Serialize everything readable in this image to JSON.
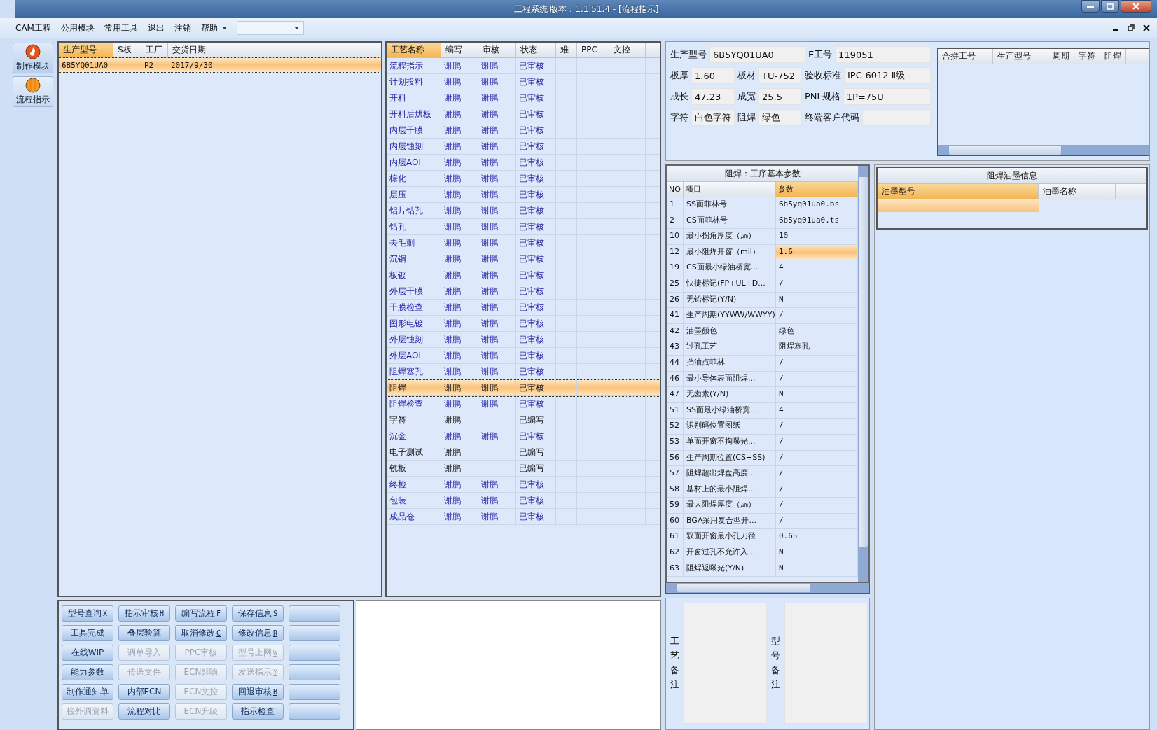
{
  "window": {
    "title": "工程系统   版本：1.1.51.4 - [流程指示]"
  },
  "menu": {
    "items": [
      "CAM工程",
      "公用模块",
      "常用工具",
      "退出",
      "注销",
      "帮助"
    ]
  },
  "nav": [
    {
      "label": "制作模块",
      "selected": true
    },
    {
      "label": "流程指示",
      "selected": false
    }
  ],
  "orders": {
    "columns": [
      {
        "label": "生产型号",
        "sorted": true
      },
      {
        "label": "S板",
        "sorted": false
      },
      {
        "label": "工厂",
        "sorted": false
      },
      {
        "label": "交货日期",
        "sorted": false
      }
    ],
    "rows": [
      {
        "model": "6B5YQ01UA0",
        "factory": "P2",
        "date": "2017/9/30",
        "selected": true
      }
    ]
  },
  "process": {
    "columns": [
      {
        "label": "工艺名称",
        "sorted": true
      },
      {
        "label": "编写",
        "sorted": false
      },
      {
        "label": "审核",
        "sorted": false
      },
      {
        "label": "状态",
        "sorted": false
      },
      {
        "label": "难",
        "sorted": false
      },
      {
        "label": "PPC",
        "sorted": false
      },
      {
        "label": "文控",
        "sorted": false
      }
    ],
    "rows": [
      {
        "name": "流程指示",
        "writer": "谢鹏",
        "reviewer": "谢鹏",
        "status": "已审核",
        "approved": true,
        "selected": false
      },
      {
        "name": "计划投料",
        "writer": "谢鹏",
        "reviewer": "谢鹏",
        "status": "已审核",
        "approved": true,
        "selected": false
      },
      {
        "name": "开料",
        "writer": "谢鹏",
        "reviewer": "谢鹏",
        "status": "已审核",
        "approved": true,
        "selected": false
      },
      {
        "name": "开料后烘板",
        "writer": "谢鹏",
        "reviewer": "谢鹏",
        "status": "已审核",
        "approved": true,
        "selected": false
      },
      {
        "name": "内层干膜",
        "writer": "谢鹏",
        "reviewer": "谢鹏",
        "status": "已审核",
        "approved": true,
        "selected": false
      },
      {
        "name": "内层蚀刻",
        "writer": "谢鹏",
        "reviewer": "谢鹏",
        "status": "已审核",
        "approved": true,
        "selected": false
      },
      {
        "name": "内层AOI",
        "writer": "谢鹏",
        "reviewer": "谢鹏",
        "status": "已审核",
        "approved": true,
        "selected": false
      },
      {
        "name": "棕化",
        "writer": "谢鹏",
        "reviewer": "谢鹏",
        "status": "已审核",
        "approved": true,
        "selected": false
      },
      {
        "name": "层压",
        "writer": "谢鹏",
        "reviewer": "谢鹏",
        "status": "已审核",
        "approved": true,
        "selected": false
      },
      {
        "name": "铝片钻孔",
        "writer": "谢鹏",
        "reviewer": "谢鹏",
        "status": "已审核",
        "approved": true,
        "selected": false
      },
      {
        "name": "钻孔",
        "writer": "谢鹏",
        "reviewer": "谢鹏",
        "status": "已审核",
        "approved": true,
        "selected": false
      },
      {
        "name": "去毛刺",
        "writer": "谢鹏",
        "reviewer": "谢鹏",
        "status": "已审核",
        "approved": true,
        "selected": false
      },
      {
        "name": "沉铜",
        "writer": "谢鹏",
        "reviewer": "谢鹏",
        "status": "已审核",
        "approved": true,
        "selected": false
      },
      {
        "name": "板镀",
        "writer": "谢鹏",
        "reviewer": "谢鹏",
        "status": "已审核",
        "approved": true,
        "selected": false
      },
      {
        "name": "外层干膜",
        "writer": "谢鹏",
        "reviewer": "谢鹏",
        "status": "已审核",
        "approved": true,
        "selected": false
      },
      {
        "name": "干膜检查",
        "writer": "谢鹏",
        "reviewer": "谢鹏",
        "status": "已审核",
        "approved": true,
        "selected": false
      },
      {
        "name": "图形电镀",
        "writer": "谢鹏",
        "reviewer": "谢鹏",
        "status": "已审核",
        "approved": true,
        "selected": false
      },
      {
        "name": "外层蚀刻",
        "writer": "谢鹏",
        "reviewer": "谢鹏",
        "status": "已审核",
        "approved": true,
        "selected": false
      },
      {
        "name": "外层AOI",
        "writer": "谢鹏",
        "reviewer": "谢鹏",
        "status": "已审核",
        "approved": true,
        "selected": false
      },
      {
        "name": "阻焊塞孔",
        "writer": "谢鹏",
        "reviewer": "谢鹏",
        "status": "已审核",
        "approved": true,
        "selected": false
      },
      {
        "name": "阻焊",
        "writer": "谢鹏",
        "reviewer": "谢鹏",
        "status": "已审核",
        "approved": true,
        "selected": true
      },
      {
        "name": "阻焊检查",
        "writer": "谢鹏",
        "reviewer": "谢鹏",
        "status": "已审核",
        "approved": true,
        "selected": false
      },
      {
        "name": "字符",
        "writer": "谢鹏",
        "status": "已编写",
        "approved": false,
        "selected": false
      },
      {
        "name": "沉金",
        "writer": "谢鹏",
        "reviewer": "谢鹏",
        "status": "已审核",
        "approved": true,
        "selected": false
      },
      {
        "name": "电子测试",
        "writer": "谢鹏",
        "status": "已编写",
        "approved": false,
        "selected": false
      },
      {
        "name": "铣板",
        "writer": "谢鹏",
        "status": "已编写",
        "approved": false,
        "selected": false
      },
      {
        "name": "终检",
        "writer": "谢鹏",
        "reviewer": "谢鹏",
        "status": "已审核",
        "approved": true,
        "selected": false
      },
      {
        "name": "包装",
        "writer": "谢鹏",
        "reviewer": "谢鹏",
        "status": "已审核",
        "approved": true,
        "selected": false
      },
      {
        "name": "成品仓",
        "writer": "谢鹏",
        "reviewer": "谢鹏",
        "status": "已审核",
        "approved": true,
        "selected": false
      }
    ]
  },
  "form": [
    [
      {
        "label": "生产型号",
        "value": "6B5YQ01UA0"
      },
      {
        "label": "E工号",
        "value": "119051"
      }
    ],
    [
      {
        "label": "板厚",
        "value": "1.60"
      },
      {
        "label": "板材",
        "value": "TU-752"
      },
      {
        "label": "验收标准",
        "value": "IPC-6012 Ⅱ级"
      }
    ],
    [
      {
        "label": "成长",
        "value": "47.23"
      },
      {
        "label": "成宽",
        "value": "25.5"
      },
      {
        "label": "PNL规格",
        "value": "1P=75U"
      }
    ],
    [
      {
        "label": "字符",
        "value": "白色字符"
      },
      {
        "label": "阻焊",
        "value": "绿色"
      },
      {
        "label": "终端客户代码"
      }
    ]
  ],
  "merge_table": {
    "columns": [
      "合拼工号",
      "生产型号",
      "周期",
      "字符",
      "阻焊"
    ]
  },
  "params": {
    "title": "阻焊：工序基本参数",
    "columns": [
      {
        "label": "NO",
        "sorted": false
      },
      {
        "label": "项目",
        "sorted": false
      },
      {
        "label": "参数",
        "sorted": true
      }
    ],
    "rows": [
      {
        "no": "1",
        "item": "SS面菲林号",
        "value": "6b5yq01ua0.bs",
        "selected": false
      },
      {
        "no": "2",
        "item": "CS面菲林号",
        "value": "6b5yq01ua0.ts",
        "selected": false
      },
      {
        "no": "10",
        "item": "最小拐角厚度（㎛）",
        "value": "10",
        "selected": false
      },
      {
        "no": "12",
        "item": "最小阻焊开窗（mil）",
        "value": "1.6",
        "selected": true
      },
      {
        "no": "19",
        "item": "CS面最小绿油桥宽...",
        "value": "4",
        "selected": false
      },
      {
        "no": "25",
        "item": "快捷标记(FP+UL+D...",
        "value": "/",
        "selected": false
      },
      {
        "no": "26",
        "item": "无铅标记(Y/N)",
        "value": "N",
        "selected": false
      },
      {
        "no": "41",
        "item": "生产周期(YYWW/WWYY)",
        "value": "/",
        "selected": false
      },
      {
        "no": "42",
        "item": "油墨颜色",
        "value": "绿色",
        "selected": false
      },
      {
        "no": "43",
        "item": "过孔工艺",
        "value": "阻焊塞孔",
        "selected": false
      },
      {
        "no": "44",
        "item": "挡油点菲林",
        "value": "/",
        "selected": false
      },
      {
        "no": "46",
        "item": "最小导体表面阻焊...",
        "value": "/",
        "selected": false
      },
      {
        "no": "47",
        "item": "无卤素(Y/N)",
        "value": "N",
        "selected": false
      },
      {
        "no": "51",
        "item": "SS面最小绿油桥宽...",
        "value": "4",
        "selected": false
      },
      {
        "no": "52",
        "item": "识别码位置图纸",
        "value": "/",
        "selected": false
      },
      {
        "no": "53",
        "item": "单面开窗不掏曝光...",
        "value": "/",
        "selected": false
      },
      {
        "no": "56",
        "item": "生产周期位置(CS+SS)",
        "value": "/",
        "selected": false
      },
      {
        "no": "57",
        "item": "阻焊超出焊盘高度...",
        "value": "/",
        "selected": false
      },
      {
        "no": "58",
        "item": "基材上的最小阻焊...",
        "value": "/",
        "selected": false
      },
      {
        "no": "59",
        "item": "最大阻焊厚度（㎛）",
        "value": "/",
        "selected": false
      },
      {
        "no": "60",
        "item": "BGA采用复合型开...",
        "value": "/",
        "selected": false
      },
      {
        "no": "61",
        "item": "双面开窗最小孔刀径",
        "value": "0.65",
        "selected": false
      },
      {
        "no": "62",
        "item": "开窗过孔不允许入...",
        "value": "N",
        "selected": false
      },
      {
        "no": "63",
        "item": "阻焊返曝光(Y/N)",
        "value": "N",
        "selected": false
      }
    ]
  },
  "ink": {
    "title": "阻焊油墨信息",
    "columns": [
      {
        "label": "油墨型号",
        "sorted": true
      },
      {
        "label": "油墨名称",
        "sorted": false
      }
    ],
    "rows": [
      {
        "selected": true
      }
    ]
  },
  "buttons": [
    [
      {
        "label": "型号查询",
        "hotkey": "X",
        "disabled": false
      },
      {
        "label": "指示审核",
        "hotkey": "H",
        "disabled": false
      },
      {
        "label": "编写流程",
        "hotkey": "F",
        "disabled": false
      },
      {
        "label": "保存信息",
        "hotkey": "S",
        "disabled": false
      },
      {
        "disabled": false
      }
    ],
    [
      {
        "label": "工具完成",
        "disabled": false
      },
      {
        "label": "叠层验算",
        "disabled": false
      },
      {
        "label": "取消修改",
        "hotkey": "C",
        "disabled": false
      },
      {
        "label": "修改信息",
        "hotkey": "R",
        "disabled": false
      },
      {
        "disabled": false
      }
    ],
    [
      {
        "label": "在线WIP",
        "disabled": false
      },
      {
        "label": "调单导入",
        "disabled": true
      },
      {
        "label": "PPC审核",
        "disabled": true
      },
      {
        "label": "型号上网",
        "hotkey": "W",
        "disabled": true
      },
      {
        "disabled": false
      }
    ],
    [
      {
        "label": "能力参数",
        "disabled": false
      },
      {
        "label": "传送文件",
        "disabled": true
      },
      {
        "label": "ECN影响",
        "disabled": true
      },
      {
        "label": "发送指示",
        "hotkey": "Y",
        "disabled": true
      },
      {
        "disabled": false
      }
    ],
    [
      {
        "label": "制作通知单",
        "disabled": false
      },
      {
        "label": "内部ECN",
        "disabled": false
      },
      {
        "label": "ECN文控",
        "disabled": true
      },
      {
        "label": "回退审核",
        "hotkey": "B",
        "disabled": false
      },
      {
        "disabled": false
      }
    ],
    [
      {
        "label": "接外调资料",
        "disabled": true
      },
      {
        "label": "流程对比",
        "disabled": false
      },
      {
        "label": "ECN升级",
        "disabled": true
      },
      {
        "label": "指示检查",
        "disabled": false
      },
      {
        "disabled": false
      }
    ]
  ],
  "notes": [
    {
      "label": "工艺备注"
    },
    {
      "label": "型号备注"
    }
  ]
}
